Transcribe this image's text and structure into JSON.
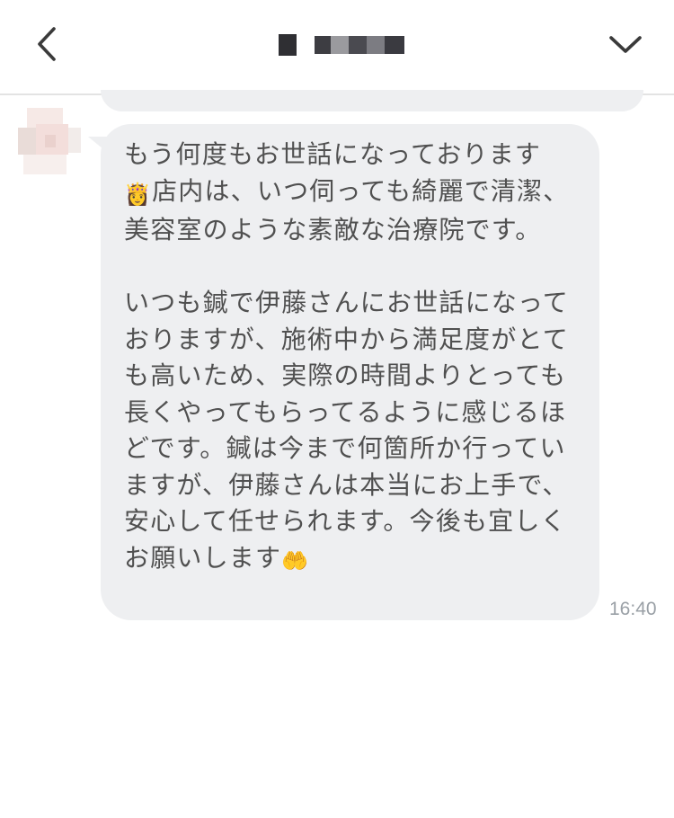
{
  "header": {
    "title_blurred": true,
    "back_icon": "chevron-left-icon",
    "menu_icon": "chevron-down-icon"
  },
  "message": {
    "paragraph1_line1": "もう何度もお世話になっております",
    "emoji_1": "👸",
    "paragraph1_rest": "店内は、いつ伺っても綺麗で清潔、美容室のような素敵な治療院です。",
    "paragraph2": "いつも鍼で伊藤さんにお世話になっておりますが、施術中から満足度がとても高いため、実際の時間よりとっても長くやってもらってるように感じるほどです。鍼は今まで何箇所か行っていますが、伊藤さんは本当にお上手で、安心して任せられます。今後も宜しくお願いします",
    "emoji_2": "🤲",
    "timestamp": "16:40"
  },
  "colors": {
    "bubble_bg": "#eeeff1",
    "text": "#505050",
    "timestamp": "#9aa0a6",
    "icon": "#3a3a3a"
  }
}
